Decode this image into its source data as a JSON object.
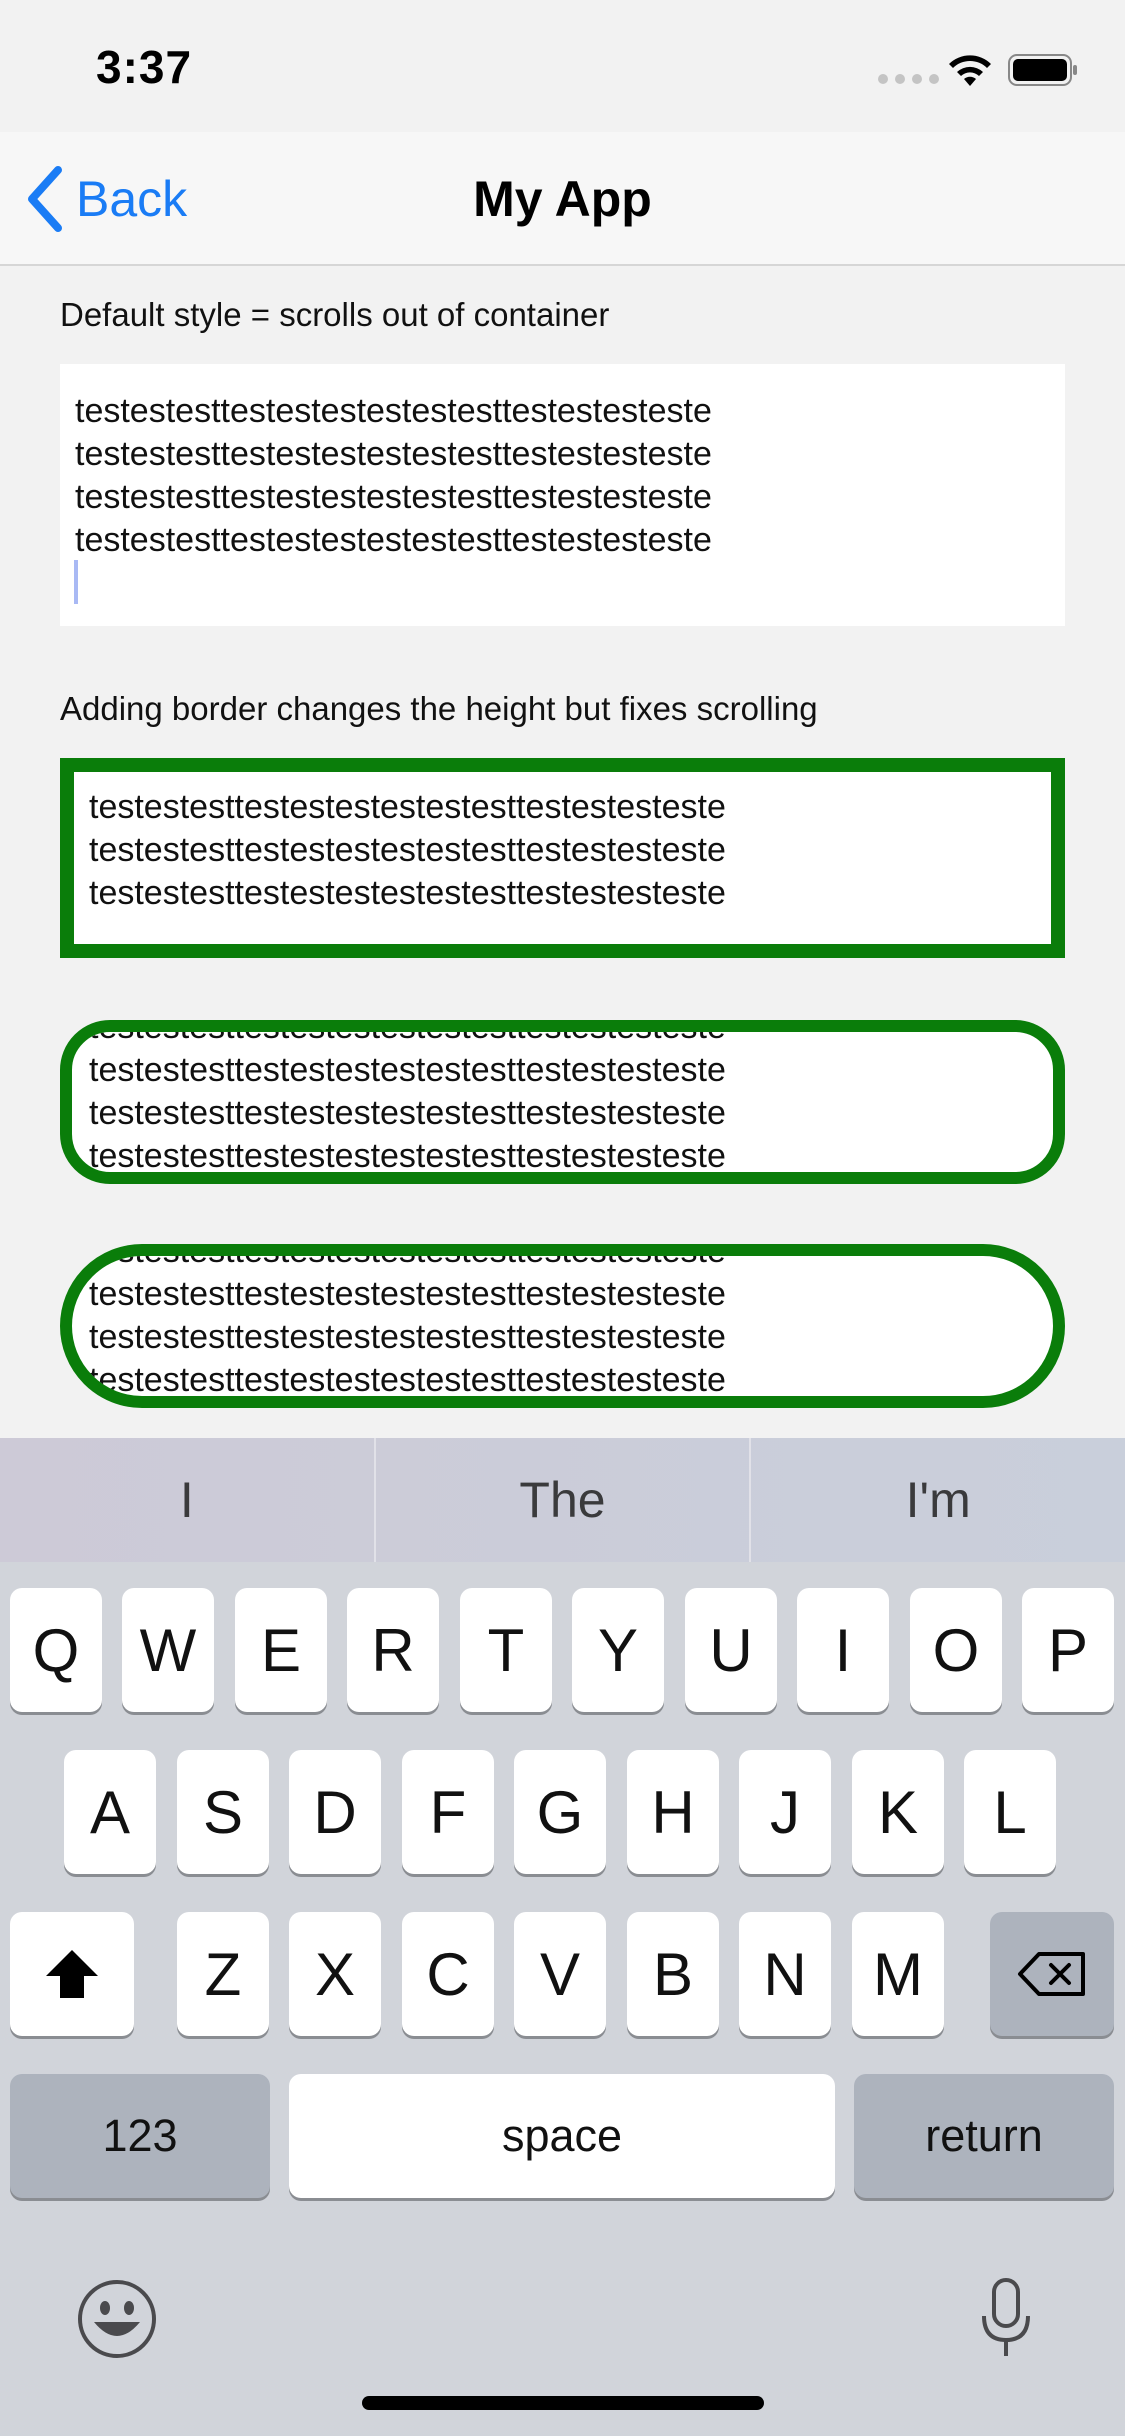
{
  "status_bar": {
    "time": "3:37"
  },
  "nav": {
    "back_label": "Back",
    "title": "My App"
  },
  "content": {
    "label_default": "Default style = scrolls out of container",
    "label_border": "Adding border changes the height but fixes scrolling",
    "tv1_text": "testestesttestestestestestesttestestesteste\ntestestesttestestestestestesttestestesteste\ntestestesttestestestestestesttestestesteste\ntestestesttestestestestestesttestestesteste",
    "tv2_text": "testestesttestestestestestesttestestesteste\ntestestesttestestestestestesttestestesteste\ntestestesttestestestestestesttestestesteste",
    "tv3_text": "testestesttestestestestestesttestestesteste\ntestestesttestestestestestesttestestesteste\ntestestesttestestestestestesttestestesteste\ntestestesttestestestestestesttestestesteste",
    "tv4_text": "testestesttestestestestestesttestestesteste\ntestestesttestestestestestesttestestesteste\ntestestesttestestestestestesttestestesteste\ntestestesttestestestestestesttestestesteste",
    "border_color": "#0a7d0a"
  },
  "keyboard": {
    "suggestions": [
      "I",
      "The",
      "I'm"
    ],
    "row1": [
      "Q",
      "W",
      "E",
      "R",
      "T",
      "Y",
      "U",
      "I",
      "O",
      "P"
    ],
    "row2": [
      "A",
      "S",
      "D",
      "F",
      "G",
      "H",
      "J",
      "K",
      "L"
    ],
    "row3": [
      "Z",
      "X",
      "C",
      "V",
      "B",
      "N",
      "M"
    ],
    "numbers_label": "123",
    "space_label": "space",
    "return_label": "return",
    "icons": [
      "shift-icon",
      "delete-icon",
      "emoji-icon",
      "microphone-icon"
    ]
  },
  "colors": {
    "accent": "#1a7cf5",
    "keyboard_bg": "#d1d4da"
  }
}
